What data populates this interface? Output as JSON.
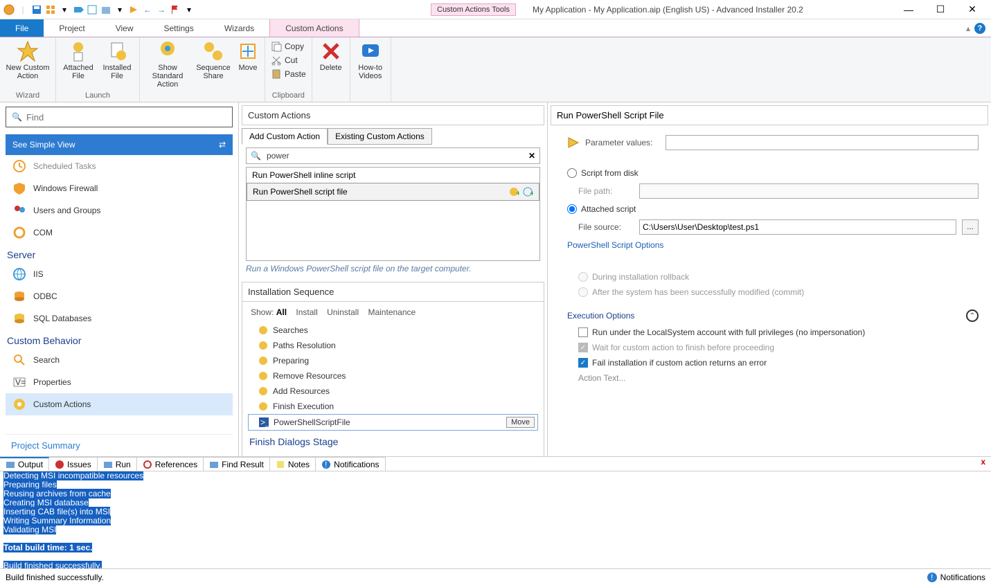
{
  "titlebar": {
    "toolsTab": "Custom Actions Tools",
    "title": "My Application - My Application.aip (English US) - Advanced Installer 20.2"
  },
  "menuTabs": {
    "file": "File",
    "project": "Project",
    "view": "View",
    "settings": "Settings",
    "wizards": "Wizards",
    "customActions": "Custom Actions"
  },
  "ribbon": {
    "newCustom": "New Custom Action",
    "attachedFile": "Attached File",
    "installedFile": "Installed File",
    "showStd": "Show Standard Action",
    "seqShare": "Sequence Share",
    "move": "Move",
    "copy": "Copy",
    "cut": "Cut",
    "paste": "Paste",
    "delete": "Delete",
    "howto": "How-to Videos",
    "grpWizard": "Wizard",
    "grpLaunch": "Launch",
    "grpClipboard": "Clipboard"
  },
  "sidebar": {
    "findPlaceholder": "Find",
    "simpleView": "See Simple View",
    "items": {
      "sched": "Scheduled Tasks",
      "wf": "Windows Firewall",
      "ug": "Users and Groups",
      "com": "COM",
      "iis": "IIS",
      "odbc": "ODBC",
      "sql": "SQL Databases",
      "search": "Search",
      "props": "Properties",
      "custom": "Custom Actions"
    },
    "catServer": "Server",
    "catBehavior": "Custom Behavior",
    "projectSummary": "Project Summary"
  },
  "center": {
    "header": "Custom Actions",
    "tabAdd": "Add Custom Action",
    "tabExisting": "Existing Custom Actions",
    "searchValue": "power",
    "res1": "Run PowerShell inline script",
    "res2": "Run PowerShell script file",
    "hint": "Run a Windows PowerShell script file on the target computer.",
    "seqHeader": "Installation Sequence",
    "showLabel": "Show:",
    "showAll": "All",
    "showInstall": "Install",
    "showUninstall": "Uninstall",
    "showMaint": "Maintenance",
    "seq": {
      "searches": "Searches",
      "paths": "Paths Resolution",
      "prep": "Preparing",
      "remove": "Remove Resources",
      "add": "Add Resources",
      "finish": "Finish Execution",
      "ps": "PowerShellScriptFile",
      "moveBtn": "Move"
    },
    "stage": "Finish Dialogs Stage"
  },
  "right": {
    "header": "Run PowerShell Script File",
    "paramLabel": "Parameter values:",
    "scriptFromDisk": "Script from disk",
    "filePath": "File path:",
    "attachedScript": "Attached script",
    "fileSource": "File source:",
    "fileSourceValue": "C:\\Users\\User\\Desktop\\test.ps1",
    "psOptions": "PowerShell Script Options",
    "rollback": "During installation rollback",
    "commit": "After the system has been successfully modified (commit)",
    "execHeader": "Execution Options",
    "runSystem": "Run under the LocalSystem account with full privileges (no impersonation)",
    "wait": "Wait for custom action to finish before proceeding",
    "fail": "Fail installation if custom action returns an error",
    "actionText": "Action Text..."
  },
  "bottom": {
    "output": "Output",
    "issues": "Issues",
    "run": "Run",
    "refs": "References",
    "findRes": "Find Result",
    "notes": "Notes",
    "notifs": "Notifications"
  },
  "outputLines": [
    "Detecting MSI incompatible resources",
    "Preparing files",
    "Reusing archives from cache",
    "Creating MSI database",
    "Inserting CAB file(s) into MSI",
    "Writing Summary Information",
    "Validating MSI",
    "",
    "Total build time: 1 sec.",
    "",
    "Build finished successfully."
  ],
  "status": {
    "msg": "Build finished successfully.",
    "notif": "Notifications"
  }
}
